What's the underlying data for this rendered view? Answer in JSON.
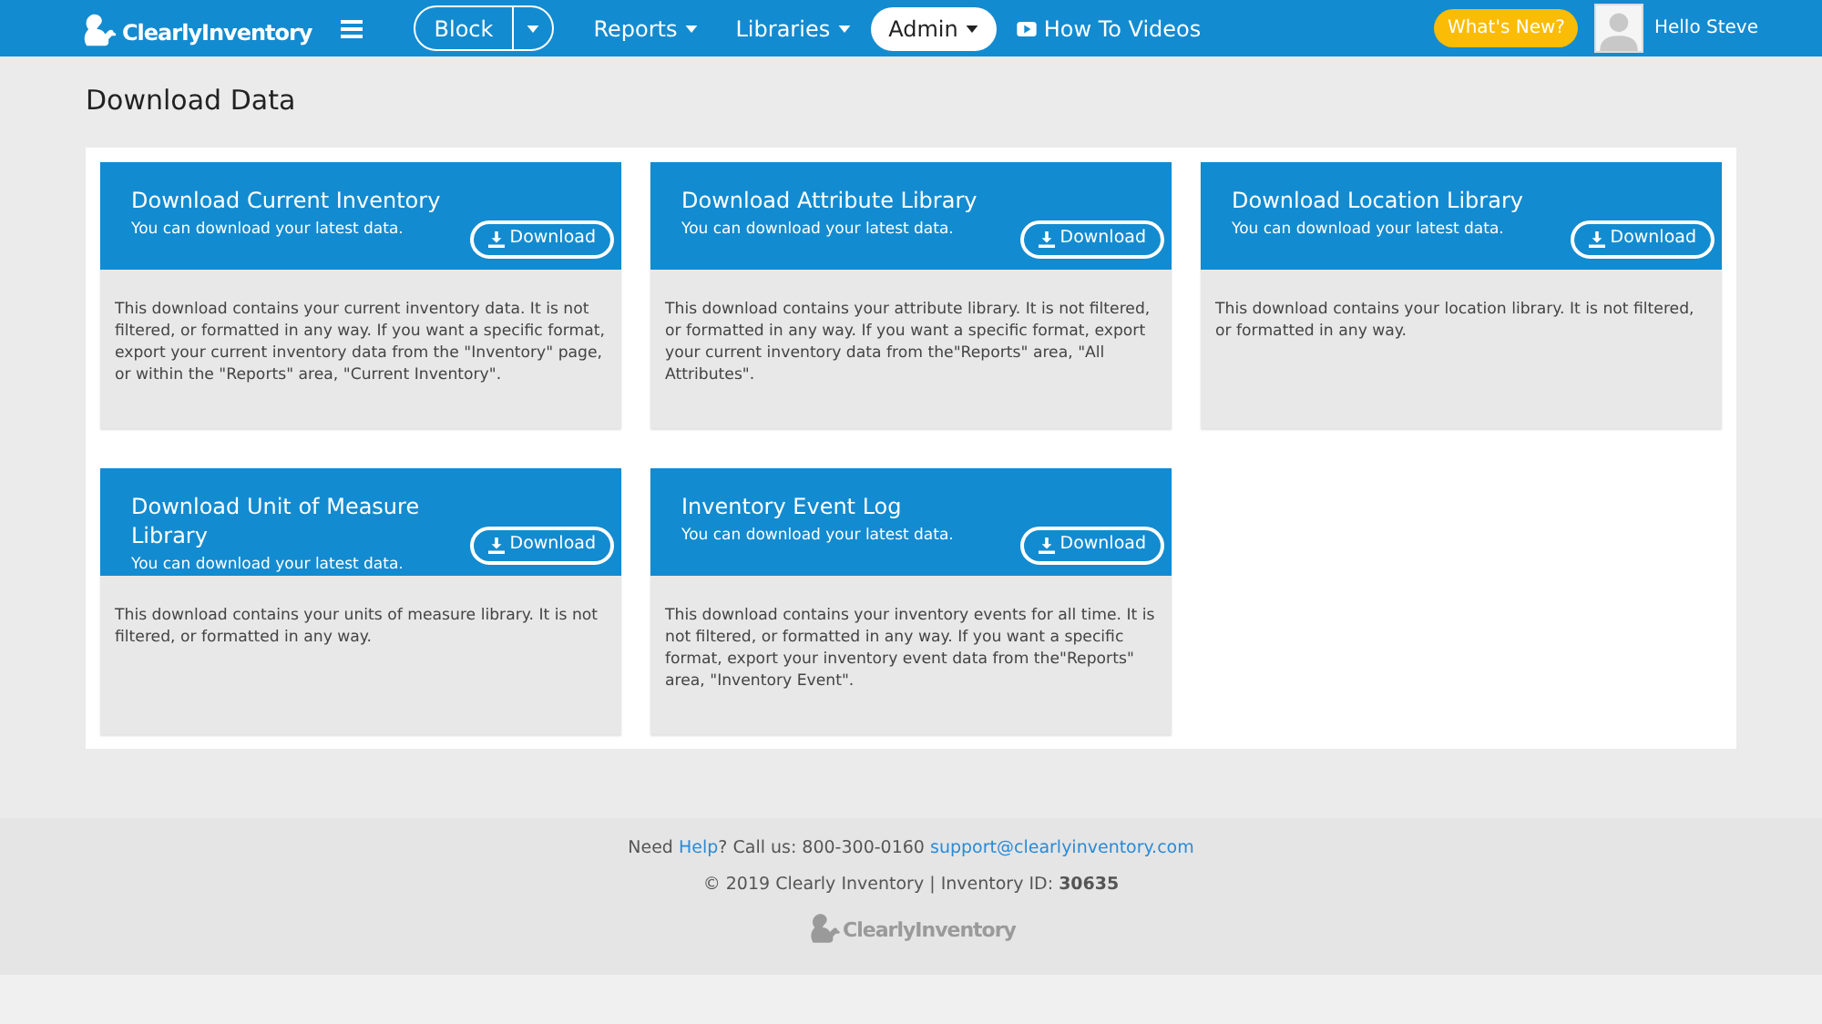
{
  "header": {
    "logo": "ClearlyInventory",
    "block_button": "Block",
    "nav": [
      {
        "label": "Reports",
        "selected": false,
        "kind": "dropdown"
      },
      {
        "label": "Libraries",
        "selected": false,
        "kind": "dropdown"
      },
      {
        "label": "Admin",
        "selected": true,
        "kind": "dropdown"
      },
      {
        "label": "How To Videos",
        "selected": false,
        "kind": "video"
      }
    ],
    "whats_new": "What's New?",
    "greeting": "Hello Steve"
  },
  "page_title": "Download Data",
  "cards": [
    {
      "title": "Download Current Inventory",
      "subtitle": "You can download your latest data.",
      "button": "Download",
      "description": "This download contains your current inventory data. It is not filtered, or formatted in any way. If you want a specific format, export your current inventory data from the \"Inventory\" page, or within the \"Reports\" area, \"Current Inventory\"."
    },
    {
      "title": "Download Attribute Library",
      "subtitle": "You can download your latest data.",
      "button": "Download",
      "description": "This download contains your attribute library. It is not filtered, or formatted in any way. If you want a specific format, export your current inventory data from the\"Reports\" area, \"All Attributes\"."
    },
    {
      "title": "Download Location Library",
      "subtitle": "You can download your latest data.",
      "button": "Download",
      "description": "This download contains your location library. It is not filtered, or formatted in any way."
    },
    {
      "title": "Download Unit of Measure Library",
      "subtitle": "You can download your latest data.",
      "button": "Download",
      "description": "This download contains your units of measure library. It is not filtered, or formatted in any way."
    },
    {
      "title": "Inventory Event Log",
      "subtitle": "You can download your latest data.",
      "button": "Download",
      "description": "This download contains your inventory events for all time. It is not filtered, or formatted in any way. If you want a specific format, export your inventory event data from the\"Reports\" area, \"Inventory Event\"."
    }
  ],
  "footer": {
    "help_before": "Need",
    "help_link": "Help",
    "help_after": "? Call us: 800-300-0160",
    "email": "support@clearlyinventory.com",
    "copyright": "© 2019 Clearly Inventory | Inventory ID: **30635**",
    "logo": "ClearlyInventory"
  }
}
